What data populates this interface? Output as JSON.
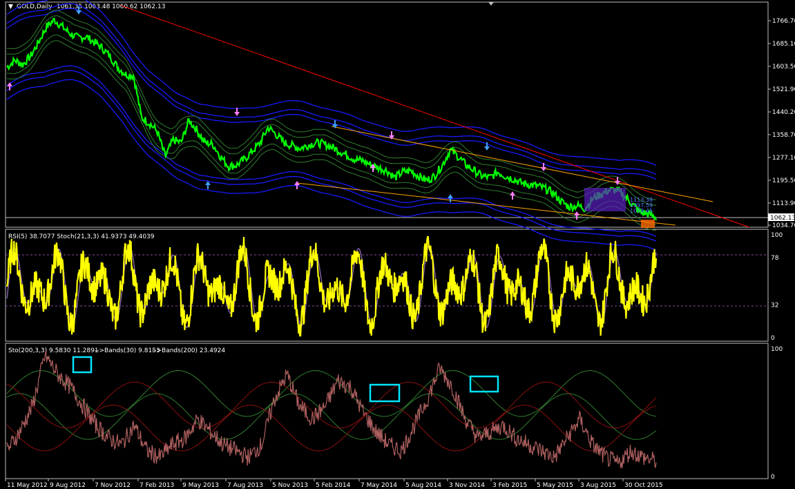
{
  "symbol_header": "GOLD,Daily",
  "ohlc_header": "1061.35 1063.48 1060.62 1062.13",
  "price_label": "1062.13",
  "colors": {
    "background": "#000000",
    "price_line": "#00ff00",
    "bands": "#1a1aff",
    "envelope": "#2f7f2f",
    "trendline_red": "#ff0000",
    "trendline_orange": "#ffa500",
    "rsi_line": "#ffff00",
    "stoch_line": "#8060a0",
    "box": "#00e5ff"
  },
  "chart_data": [
    {
      "type": "line",
      "name": "price",
      "title": "GOLD,Daily",
      "yticks": [
        "1766.70",
        "1685.10",
        "1603.50",
        "1521.90",
        "1440.20",
        "1358.70",
        "1277.10",
        "1195.50",
        "1113.90",
        "1034.70"
      ],
      "ylim": [
        1034.7,
        1766.7
      ],
      "xticks": [
        "11 May 2012",
        "9 Aug 2012",
        "7 Nov 2012",
        "7 Feb 2013",
        "9 May 2013",
        "7 Aug 2013",
        "5 Nov 2013",
        "5 Feb 2014",
        "7 May 2014",
        "5 Aug 2014",
        "3 Nov 2014",
        "3 Feb 2015",
        "5 May 2015",
        "3 Aug 2015",
        "30 Oct 2015"
      ],
      "series": [
        {
          "name": "close",
          "values": [
            1600,
            1625,
            1610,
            1640,
            1690,
            1745,
            1770,
            1745,
            1720,
            1705,
            1710,
            1690,
            1670,
            1640,
            1600,
            1575,
            1570,
            1420,
            1400,
            1370,
            1280,
            1340,
            1330,
            1410,
            1375,
            1330,
            1325,
            1280,
            1245,
            1250,
            1270,
            1300,
            1330,
            1385,
            1360,
            1330,
            1320,
            1310,
            1320,
            1330,
            1325,
            1315,
            1300,
            1285,
            1270,
            1265,
            1250,
            1240,
            1230,
            1205,
            1225,
            1230,
            1210,
            1195,
            1210,
            1250,
            1305,
            1280,
            1250,
            1230,
            1210,
            1205,
            1225,
            1210,
            1200,
            1185,
            1180,
            1175,
            1165,
            1150,
            1120,
            1100,
            1105,
            1095,
            1130,
            1145,
            1160,
            1160,
            1140,
            1110,
            1080,
            1075,
            1062
          ]
        }
      ],
      "arrows_up": 6,
      "arrows_down": 9,
      "inline_labels": [
        "1113.38",
        "1097.59",
        "1078.45"
      ]
    },
    {
      "type": "line",
      "title": "RSI(5) 38.7077  Stoch(21,3,3) 41.9373 49.4039",
      "yticks": [
        "100",
        "78",
        "32",
        "0"
      ],
      "ylim": [
        0,
        100
      ],
      "levels": [
        78,
        32
      ]
    },
    {
      "type": "line",
      "title": "Sto(200,3,3) 9.5830 11.2891",
      "legend": [
        {
          "label": "-->Bands(30) 9.8153",
          "color": "#2f7f2f"
        },
        {
          "label": "-->Bands(200) 23.4924",
          "color": "#ff2020"
        }
      ],
      "yticks": [
        "100",
        "0"
      ],
      "ylim": [
        0,
        100
      ],
      "highlight_boxes": 3
    }
  ]
}
